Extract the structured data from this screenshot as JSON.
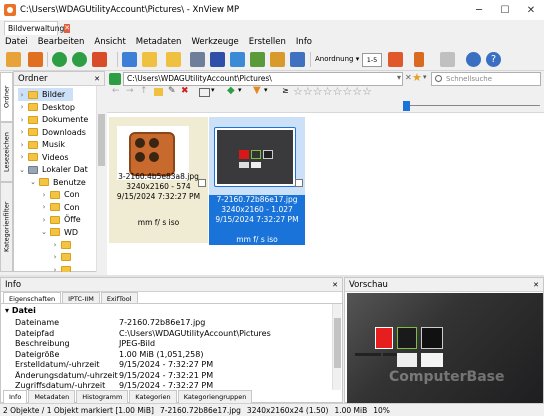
{
  "window": {
    "title": "C:\\Users\\WDAGUtilityAccount\\Pictures\\ - XnView MP"
  },
  "tab": {
    "label": "Bildverwaltung"
  },
  "menu": [
    "Datei",
    "Bearbeiten",
    "Ansicht",
    "Metadaten",
    "Werkzeuge",
    "Erstellen",
    "Info"
  ],
  "toolbar": {
    "arrange_label": "Anordnung",
    "page_label": "1-5"
  },
  "folders_panel": {
    "title": "Ordner",
    "tree": [
      {
        "label": "Bilder",
        "depth": 0,
        "expanded": false,
        "selected": true
      },
      {
        "label": "Desktop",
        "depth": 0,
        "expanded": false
      },
      {
        "label": "Dokumente",
        "depth": 0,
        "expanded": false
      },
      {
        "label": "Downloads",
        "depth": 0,
        "expanded": false
      },
      {
        "label": "Musik",
        "depth": 0,
        "expanded": false
      },
      {
        "label": "Videos",
        "depth": 0,
        "expanded": false
      },
      {
        "label": "Lokaler Dat",
        "depth": 0,
        "expanded": true,
        "drive": true
      },
      {
        "label": "Benutze",
        "depth": 1,
        "expanded": true
      },
      {
        "label": "Con",
        "depth": 2,
        "expanded": false
      },
      {
        "label": "Con",
        "depth": 2,
        "expanded": false
      },
      {
        "label": "Öffe",
        "depth": 2,
        "expanded": false
      },
      {
        "label": "WD",
        "depth": 2,
        "expanded": true
      },
      {
        "label": "",
        "depth": 3,
        "expanded": false
      },
      {
        "label": "",
        "depth": 3,
        "expanded": false
      },
      {
        "label": "",
        "depth": 3,
        "expanded": false
      }
    ]
  },
  "vertical_tabs": [
    "Ordner",
    "Lesezeichen",
    "Kategorienfilter"
  ],
  "address": {
    "path": "C:\\Users\\WDAGUtilityAccount\\Pictures\\",
    "search_placeholder": "Schnellsuche"
  },
  "filter_bar": {
    "rating_symbol": "≥"
  },
  "thumbnails": [
    {
      "name": "3-2160.4b5e83a8.jpg",
      "dims": "3240x2160 - 574",
      "date": "9/15/2024 7:32:27 PM",
      "exif": "mm f/ s iso",
      "selected": false
    },
    {
      "name": "7-2160.72b86e17.jpg",
      "dims": "3240x2160 - 1.027",
      "date": "9/15/2024 7:32:27 PM",
      "exif": "mm f/ s iso",
      "selected": true
    }
  ],
  "info_panel": {
    "title": "Info",
    "tabs": [
      "Eigenschaften",
      "IPTC-IIM",
      "ExifTool"
    ],
    "section": "Datei",
    "rows": [
      {
        "name": "Dateiname",
        "value": "7-2160.72b86e17.jpg"
      },
      {
        "name": "Dateipfad",
        "value": "C:\\Users\\WDAGUtilityAccount\\Pictures"
      },
      {
        "name": "Beschreibung",
        "value": "JPEG-Bild"
      },
      {
        "name": "Dateigröße",
        "value": "1.00 MiB (1,051,258)"
      },
      {
        "name": "Erstelldatum/-uhrzeit",
        "value": "9/15/2024 - 7:32:27 PM"
      },
      {
        "name": "Änderungsdatum/-uhrzeit",
        "value": "9/15/2024 - 7:32:21 PM"
      },
      {
        "name": "Zugriffsdatum/-uhrzeit",
        "value": "9/15/2024 - 7:32:27 PM"
      }
    ],
    "bottom_tabs": [
      "Info",
      "Metadaten",
      "Histogramm",
      "Kategorien",
      "Kategoriengruppen"
    ]
  },
  "preview_panel": {
    "title": "Vorschau",
    "watermark": "ComputerBase"
  },
  "status": {
    "selection": "2 Objekte / 1 Objekt markiert [1.00 MiB]",
    "filename": "7-2160.72b86e17.jpg",
    "info": "3240x2160x24 (1.50)",
    "size": "1.00 MiB",
    "zoom": "10%"
  },
  "colors": {
    "selection_blue": "#1a73d9",
    "thumb_highlight": "#cce0f7",
    "tan_card": "#f0ecd4"
  }
}
